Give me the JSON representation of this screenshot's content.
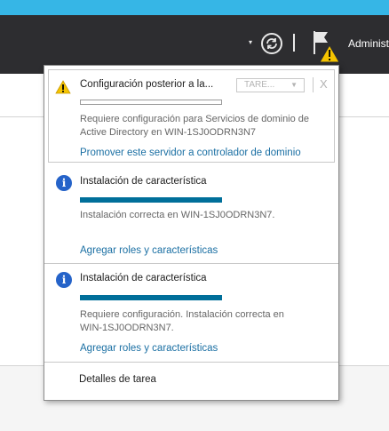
{
  "header": {
    "admin_label": "Administ",
    "accent_color": "#36b6e6",
    "bar_color": "#2d2d30"
  },
  "notifications": [
    {
      "type": "warning",
      "icon": "warning-icon",
      "title": "Configuración posterior a la...",
      "task_button": "TARE...",
      "close": "X",
      "progress": 0,
      "description": [
        "Requiere configuración para Servicios de dominio de",
        "Active Directory en WIN-1SJ0ODRN3N7"
      ],
      "link": "Promover este servidor a controlador de dominio"
    },
    {
      "type": "info",
      "icon": "info-icon",
      "title": "Instalación de característica",
      "progress": 1,
      "description": [
        "Instalación correcta en WIN-1SJ0ODRN3N7."
      ],
      "link": "Agregar roles y características"
    },
    {
      "type": "info",
      "icon": "info-icon",
      "title": "Instalación de característica",
      "progress": 1,
      "description": [
        "Requiere configuración. Instalación correcta en",
        "WIN-1SJ0ODRN3N7."
      ],
      "link": "Agregar roles y características"
    }
  ],
  "footer": {
    "details_label": "Detalles de tarea"
  }
}
